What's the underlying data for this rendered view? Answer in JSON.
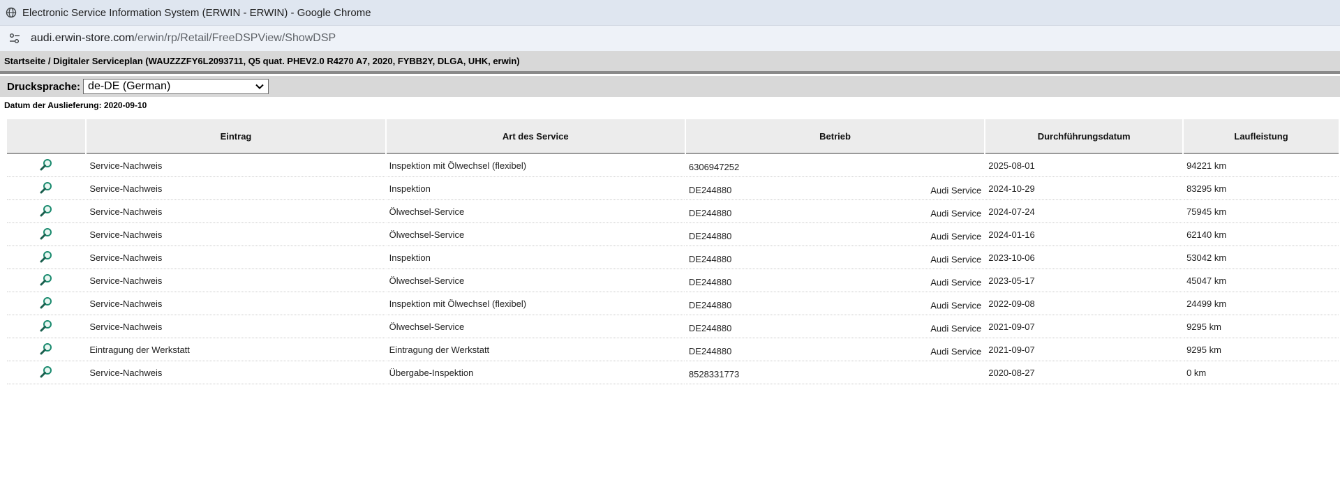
{
  "window": {
    "title": "Electronic Service Information System (ERWIN - ERWIN) - Google Chrome"
  },
  "address": {
    "host": "audi.erwin-store.com",
    "path": "/erwin/rp/Retail/FreeDSPView/ShowDSP"
  },
  "breadcrumb": "Startseite / Digitaler Serviceplan (WAUZZZFY6L2093711, Q5 quat. PHEV2.0 R4270 A7, 2020, FYBB2Y, DLGA, UHK, erwin)",
  "language": {
    "label": "Drucksprache:",
    "selected": "de-DE (German)"
  },
  "delivery": "Datum der Auslieferung: 2020-09-10",
  "table": {
    "headers": [
      "",
      "Eintrag",
      "Art des Service",
      "Betrieb",
      "Durchführungsdatum",
      "Laufleistung"
    ],
    "rows": [
      {
        "entry": "Service-Nachweis",
        "art": "Inspektion mit Ölwechsel (flexibel)",
        "code": "6306947252",
        "name": "",
        "date": "2025-08-01",
        "km": "94221 km"
      },
      {
        "entry": "Service-Nachweis",
        "art": "Inspektion",
        "code": "DE244880",
        "name": "Audi Service",
        "date": "2024-10-29",
        "km": "83295 km"
      },
      {
        "entry": "Service-Nachweis",
        "art": "Ölwechsel-Service",
        "code": "DE244880",
        "name": "Audi Service",
        "date": "2024-07-24",
        "km": "75945 km"
      },
      {
        "entry": "Service-Nachweis",
        "art": "Ölwechsel-Service",
        "code": "DE244880",
        "name": "Audi Service",
        "date": "2024-01-16",
        "km": "62140 km"
      },
      {
        "entry": "Service-Nachweis",
        "art": "Inspektion",
        "code": "DE244880",
        "name": "Audi Service",
        "date": "2023-10-06",
        "km": "53042 km"
      },
      {
        "entry": "Service-Nachweis",
        "art": "Ölwechsel-Service",
        "code": "DE244880",
        "name": "Audi Service",
        "date": "2023-05-17",
        "km": "45047 km"
      },
      {
        "entry": "Service-Nachweis",
        "art": "Inspektion mit Ölwechsel (flexibel)",
        "code": "DE244880",
        "name": "Audi Service",
        "date": "2022-09-08",
        "km": "24499 km"
      },
      {
        "entry": "Service-Nachweis",
        "art": "Ölwechsel-Service",
        "code": "DE244880",
        "name": "Audi Service",
        "date": "2021-09-07",
        "km": "9295 km"
      },
      {
        "entry": "Eintragung der Werkstatt",
        "art": "Eintragung der Werkstatt",
        "code": "DE244880",
        "name": "Audi Service",
        "date": "2021-09-07",
        "km": "9295 km"
      },
      {
        "entry": "Service-Nachweis",
        "art": "Übergabe-Inspektion",
        "code": "8528331773",
        "name": "",
        "date": "2020-08-27",
        "km": "0 km"
      }
    ]
  },
  "icons": {
    "title": "globe-icon",
    "address": "site-settings-icon",
    "row": "magnifier-icon",
    "select": "chevron-down-icon"
  },
  "colors": {
    "magnifier": "#1a8a6e"
  }
}
